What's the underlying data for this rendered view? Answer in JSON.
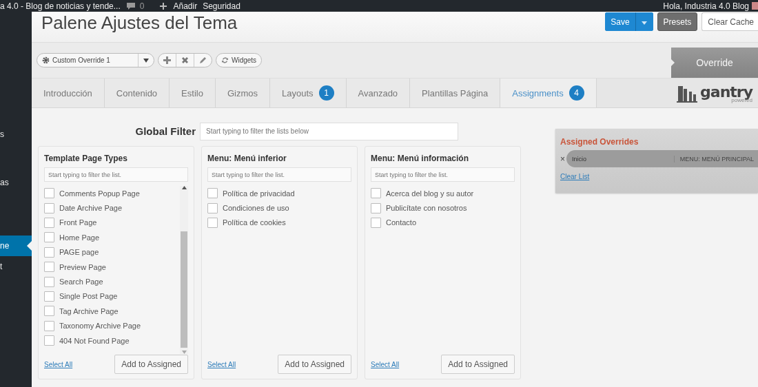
{
  "admin_bar": {
    "site_title": "a 4.0 - Blog de noticias y tende...",
    "comments": "0",
    "new": "Añadir",
    "security": "Seguridad",
    "greeting": "Hola, Industria 4.0 Blog"
  },
  "sidebar": {
    "items": [
      {
        "label": "s",
        "selected": false
      },
      {
        "label": "as",
        "selected": false
      },
      {
        "label": "ne",
        "selected": true
      },
      {
        "label": "t",
        "selected": false
      }
    ]
  },
  "page_title": "Palene Ajustes del Tema",
  "header_buttons": {
    "save": "Save",
    "presets": "Presets",
    "clear_cache": "Clear Cache"
  },
  "toolbar": {
    "override_select": "Custom Override 1",
    "widgets": "Widgets",
    "override_label": "Override"
  },
  "tabs": [
    {
      "label": "Introducción",
      "selected": false
    },
    {
      "label": "Contenido",
      "selected": false
    },
    {
      "label": "Estilo",
      "selected": false
    },
    {
      "label": "Gizmos",
      "selected": false
    },
    {
      "label": "Layouts",
      "badge": "1",
      "selected": false
    },
    {
      "label": "Avanzado",
      "selected": false
    },
    {
      "label": "Plantillas Página",
      "selected": false
    },
    {
      "label": "Assignments",
      "badge": "4",
      "selected": true
    }
  ],
  "logo": {
    "name": "gantry",
    "tagline": "powered"
  },
  "global_filter": {
    "label": "Global Filter",
    "placeholder": "Start typing to filter the lists below"
  },
  "panels": [
    {
      "title": "Template Page Types",
      "placeholder": "Start typing to filter the list.",
      "items": [
        {
          "label": "Comments Popup Page",
          "checked": false
        },
        {
          "label": "Date Archive Page",
          "checked": false
        },
        {
          "label": "Front Page",
          "checked": false
        },
        {
          "label": "Home Page",
          "checked": false
        },
        {
          "label": "PAGE page",
          "checked": false
        },
        {
          "label": "Preview Page",
          "checked": false
        },
        {
          "label": "Search Page",
          "checked": false
        },
        {
          "label": "Single Post Page",
          "checked": false
        },
        {
          "label": "Tag Archive Page",
          "checked": false
        },
        {
          "label": "Taxonomy Archive Page",
          "checked": false
        },
        {
          "label": "404 Not Found Page",
          "checked": false
        }
      ],
      "select_all": "Select All",
      "add_button": "Add to Assigned"
    },
    {
      "title": "Menu: Menú inferior",
      "placeholder": "Start typing to filter the list.",
      "items": [
        {
          "label": "Política de privacidad",
          "checked": false
        },
        {
          "label": "Condiciones de uso",
          "checked": false
        },
        {
          "label": "Política de cookies",
          "checked": false
        }
      ],
      "select_all": "Select All",
      "add_button": "Add to Assigned"
    },
    {
      "title": "Menu: Menú información",
      "placeholder": "Start typing to filter the list.",
      "items": [
        {
          "label": "Acerca del blog y su autor",
          "checked": false
        },
        {
          "label": "Publicítate con nosotros",
          "checked": false
        },
        {
          "label": "Contacto",
          "checked": false
        }
      ],
      "select_all": "Select All",
      "add_button": "Add to Assigned"
    }
  ],
  "assigned": {
    "title": "Assigned Overrides",
    "items": [
      {
        "remove": "×",
        "name": "Inicio",
        "group": "MENU: MENÚ PRINCIPAL"
      }
    ],
    "clear": "Clear List"
  }
}
